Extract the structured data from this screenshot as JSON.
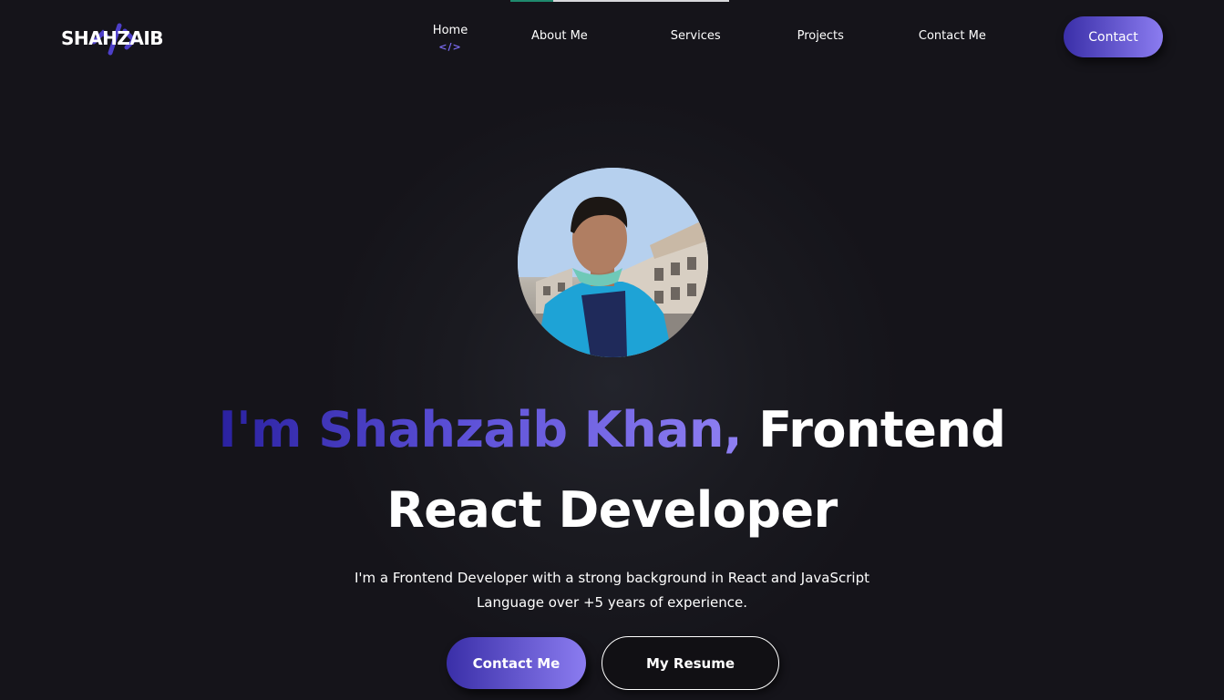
{
  "header": {
    "logo_text": "SHAHZAIB",
    "nav": [
      {
        "label": "Home",
        "icon": "</>",
        "active": true
      },
      {
        "label": "About Me"
      },
      {
        "label": "Services"
      },
      {
        "label": "Projects"
      },
      {
        "label": "Contact Me"
      }
    ],
    "contact_button": "Contact"
  },
  "hero": {
    "avatar_icon": "profile-photo",
    "title_name": "I'm Shahzaib Khan,",
    "title_role_1": "Frontend",
    "title_role_2": "React Developer",
    "description_line_1": "I'm a Frontend Developer with a strong background in React and JavaScript",
    "description_line_2": "Language over +5 years of experience.",
    "primary_button": "Contact Me",
    "secondary_button": "My Resume"
  },
  "colors": {
    "background": "#15141a",
    "accent_start": "#3a2fa8",
    "accent_end": "#8b7cf0",
    "progress": "#1f8a6e"
  }
}
